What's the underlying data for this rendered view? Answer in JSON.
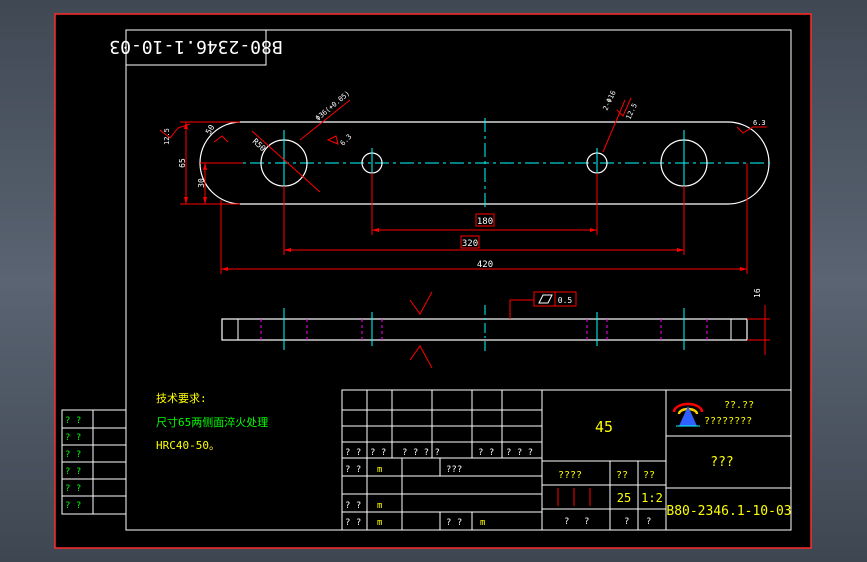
{
  "drawing_code_rotated": "B80-2346.1-10-03",
  "drawing_code": "B80-2346.1-10-03",
  "material": "45",
  "title_company": "??.??",
  "title_company2": "????????",
  "title_part": "???",
  "scale_header": "????",
  "weight_header1": "??",
  "weight_header2": "??",
  "quantity": "25",
  "scale_value": "1:2",
  "sheet_left": "?",
  "sheet_left2": "?",
  "sheet_right": "?",
  "sheet_right2": "?",
  "tech_title": "技术要求:",
  "tech_line1": "尺寸65两侧面淬火处理",
  "tech_line2": "HRC40-50。",
  "left_labels": [
    "? ?",
    "? ?",
    "? ?",
    "? ?",
    "? ?",
    "? ?"
  ],
  "rev_row_a": [
    "? ?",
    "? ?",
    "? ? ? ?",
    "? ?",
    "? ? ?"
  ],
  "rev_row_b": [
    "? ?",
    "???"
  ],
  "rev_row_c": [
    "? ?",
    "? ?"
  ],
  "rev_row_d": [
    "? ?",
    "? ?",
    "? ?"
  ],
  "rev_marks": [
    "m",
    "m",
    "m",
    "m"
  ],
  "dims": {
    "d180": "180",
    "d320": "320",
    "d420": "420",
    "d65": "65",
    "d30": "30",
    "d16": "16",
    "r50": "R50",
    "s50": "50",
    "hole_big": "Φ36(+0.05)",
    "hole_small": "2-Φ16",
    "ra_top": "6.3",
    "ra_hole": "12.5",
    "ra_left": "12.5",
    "ra_right": "6.3",
    "flatness": "0.5"
  },
  "colors": {
    "frame": "#ffffff",
    "outline": "#ffffff",
    "dimension": "#ff0000",
    "centerline": "#00ffff",
    "hidden": "#ff00ff",
    "text_green": "#00ff00",
    "text_yellow": "#ffff00",
    "background": "#000000"
  }
}
